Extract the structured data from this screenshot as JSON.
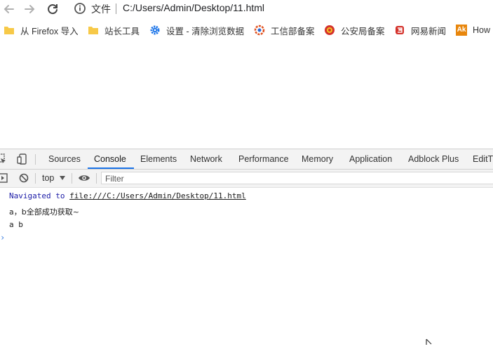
{
  "toolbar": {
    "back_icon": "arrow-left-icon",
    "forward_icon": "arrow-right-icon",
    "reload_icon": "reload-icon",
    "info_icon": "info-icon",
    "address_label": "文件",
    "address_url": "C:/Users/Admin/Desktop/11.html"
  },
  "bookmarks": [
    {
      "label": "从 Firefox 导入",
      "icon": "folder-icon"
    },
    {
      "label": "站长工具",
      "icon": "folder-icon"
    },
    {
      "label": "设置 - 清除浏览数据",
      "icon": "gear-icon"
    },
    {
      "label": "工信部备案",
      "icon": "miit-logo-icon"
    },
    {
      "label": "公安局备案",
      "icon": "police-emblem-icon"
    },
    {
      "label": "网易新闻",
      "icon": "netease-icon"
    },
    {
      "label": "How",
      "icon": "ak-icon",
      "icon_text": "Ak"
    }
  ],
  "devtools": {
    "tabs": [
      "Sources",
      "Console",
      "Elements",
      "Network",
      "Performance",
      "Memory",
      "Application",
      "Adblock Plus",
      "EditTh"
    ],
    "active_tab": "Console",
    "context": "top",
    "filter_placeholder": "Filter",
    "console": {
      "nav_prefix": "Navigated to ",
      "nav_url": "file:///C:/Users/Admin/Desktop/11.html",
      "log1": "a，b全部成功获取~",
      "log2": "a b",
      "prompt": "›"
    }
  },
  "colors": {
    "accent": "#1a73e8",
    "nav_message": "#1a1aa6",
    "folder": "#f7c948"
  }
}
